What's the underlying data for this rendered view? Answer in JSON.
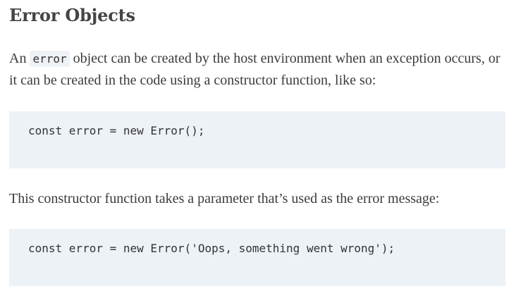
{
  "heading": "Error Objects",
  "para1": {
    "before": "An ",
    "code": "error",
    "after": " object can be created by the host environment when an exception oc­curs, or it can be created in the code using a constructor function, like so:"
  },
  "code1": "const error = new Error();",
  "para2": "This constructor function takes a parameter that’s used as the error message:",
  "code2": "const error = new Error('Oops, something went wrong');"
}
